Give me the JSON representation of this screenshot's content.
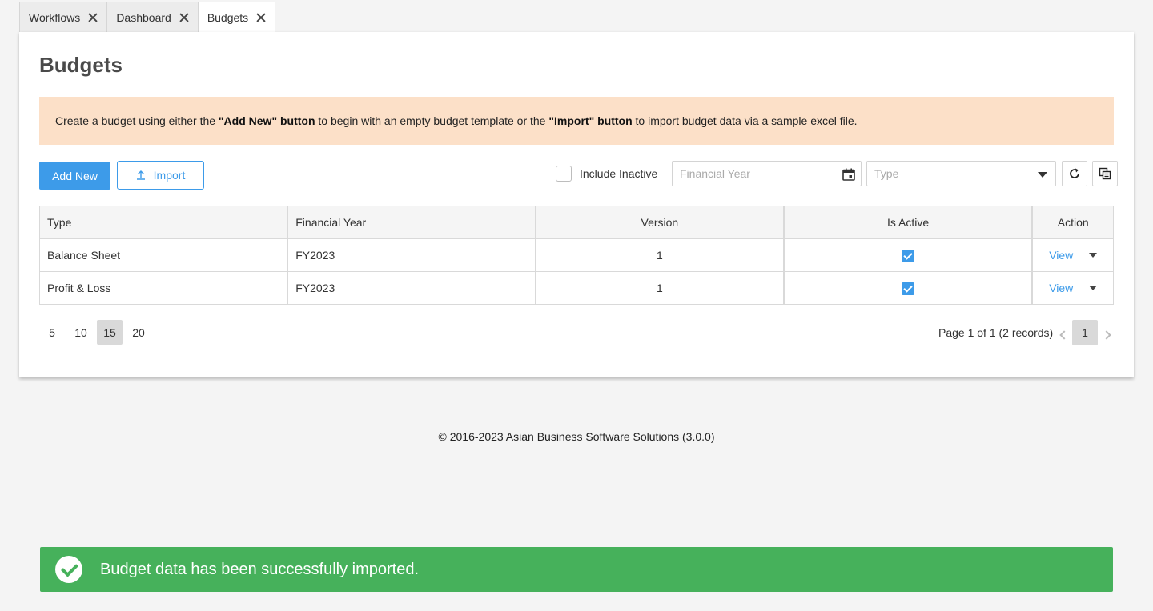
{
  "tabs": [
    {
      "label": "Workflows"
    },
    {
      "label": "Dashboard"
    },
    {
      "label": "Budgets"
    }
  ],
  "page": {
    "title": "Budgets",
    "notice": {
      "part1": "Create a budget using either the ",
      "bold1": "\"Add New\" button",
      "part2": " to begin with an empty budget template or the ",
      "bold2": "\"Import\" button",
      "part3": " to import budget data via a sample excel file."
    }
  },
  "toolbar": {
    "add_label": "Add New",
    "import_label": "Import",
    "include_inactive_label": "Include Inactive",
    "financial_year_placeholder": "Financial Year",
    "type_placeholder": "Type"
  },
  "table": {
    "headers": [
      "Type",
      "Financial Year",
      "Version",
      "Is Active",
      "Action"
    ],
    "rows": [
      {
        "type": "Balance Sheet",
        "financial_year": "FY2023",
        "version": "1",
        "is_active": true,
        "action": "View"
      },
      {
        "type": "Profit & Loss",
        "financial_year": "FY2023",
        "version": "1",
        "is_active": true,
        "action": "View"
      }
    ]
  },
  "pager": {
    "page_sizes": [
      "5",
      "10",
      "15",
      "20"
    ],
    "selected_page_size": "15",
    "info": "Page 1 of 1 (2 records)",
    "current_page": "1"
  },
  "footer": "© 2016-2023 Asian Business Software Solutions (3.0.0)",
  "toast": "Budget data has been successfully imported.",
  "colors": {
    "primary": "#3d9be9",
    "notice_bg": "#fce0c8",
    "success": "#46b15b"
  }
}
